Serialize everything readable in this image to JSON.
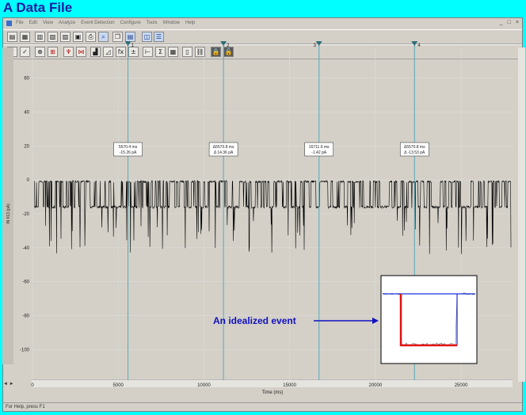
{
  "title": "A Data File",
  "menu": [
    "File",
    "Edit",
    "View",
    "Analyze",
    "Event Detection",
    "Configure",
    "Tools",
    "Window",
    "Help"
  ],
  "window_controls": [
    "_",
    "□",
    "×"
  ],
  "toolbar1": [
    {
      "name": "open-file-icon",
      "glyph": "▤"
    },
    {
      "name": "open-data-icon",
      "glyph": "▦"
    },
    {
      "name": "open-protocol-icon",
      "glyph": "▥"
    },
    {
      "name": "open-multiple-icon",
      "glyph": "▧"
    },
    {
      "name": "close-icon",
      "glyph": "▨"
    },
    {
      "name": "save-icon",
      "glyph": "▣"
    },
    {
      "name": "print-icon",
      "glyph": "⎙"
    },
    {
      "name": "print-preview-icon",
      "glyph": "⌕"
    },
    {
      "name": "copy-icon",
      "glyph": "❐"
    },
    {
      "name": "results-icon",
      "glyph": "▤"
    },
    {
      "name": "window-tile-icon",
      "glyph": "◫"
    },
    {
      "name": "window-cascade-icon",
      "glyph": "☰"
    }
  ],
  "toolbar2": [
    {
      "name": "accept-icon",
      "glyph": "✓"
    },
    {
      "name": "accept-all-icon",
      "glyph": "✓"
    },
    {
      "name": "zoom-icon",
      "glyph": "⊕"
    },
    {
      "name": "zoom-fit-icon",
      "glyph": "⊞"
    },
    {
      "name": "event-detect-icon",
      "glyph": "♆"
    },
    {
      "name": "template-icon",
      "glyph": "⋈"
    },
    {
      "name": "histogram-icon",
      "glyph": "▟"
    },
    {
      "name": "graph-icon",
      "glyph": "◿"
    },
    {
      "name": "function-icon",
      "glyph": "fx"
    },
    {
      "name": "arithmetic-icon",
      "glyph": "±"
    },
    {
      "name": "cursor-icon",
      "glyph": "⊢"
    },
    {
      "name": "statistics-icon",
      "glyph": "Σ"
    },
    {
      "name": "table-icon",
      "glyph": "▦"
    },
    {
      "name": "notebook-icon",
      "glyph": "▯"
    },
    {
      "name": "link-icon",
      "glyph": "⛓"
    },
    {
      "name": "lock-icon",
      "glyph": "🔒"
    },
    {
      "name": "unlock-icon",
      "glyph": "🔓"
    }
  ],
  "axis_label": "IN #13 (pA)",
  "status_text": "For Help, press F1",
  "cursors": [
    {
      "number": "1",
      "x": 5570.4,
      "line1": "5570.4 ms",
      "line2": "-15.26 pA"
    },
    {
      "number": "2",
      "x": 11140.8,
      "line1": "Δ5570.8 ms",
      "line2": "Δ 14.36 pA"
    },
    {
      "number": "3",
      "x": 16711.6,
      "line1": "16711.6 ms",
      "line2": "-1.42 pA"
    },
    {
      "number": "4",
      "x": 22282.4,
      "line1": "Δ5570.8 ms",
      "line2": "Δ -13.53 pA"
    }
  ],
  "annotation": "An idealized event",
  "colors": {
    "background": "#00ffff",
    "title": "#1a1aa0",
    "cursor": "#5aa8b8",
    "annotation": "#1010c0",
    "idealized": "#e01010",
    "raw": "#1a30e0"
  },
  "chart_data": {
    "type": "line",
    "xlabel": "Time (ms)",
    "ylabel": "IN #13 (pA)",
    "xlim": [
      0,
      28000
    ],
    "ylim": [
      -118,
      78
    ],
    "x_ticks": [
      0,
      5000,
      10000,
      15000,
      20000,
      25000
    ],
    "y_ticks": [
      60,
      40,
      20,
      0,
      -20,
      -40,
      -60,
      -80,
      -100
    ],
    "baseline": -1,
    "open_level": -16,
    "grid": true
  }
}
